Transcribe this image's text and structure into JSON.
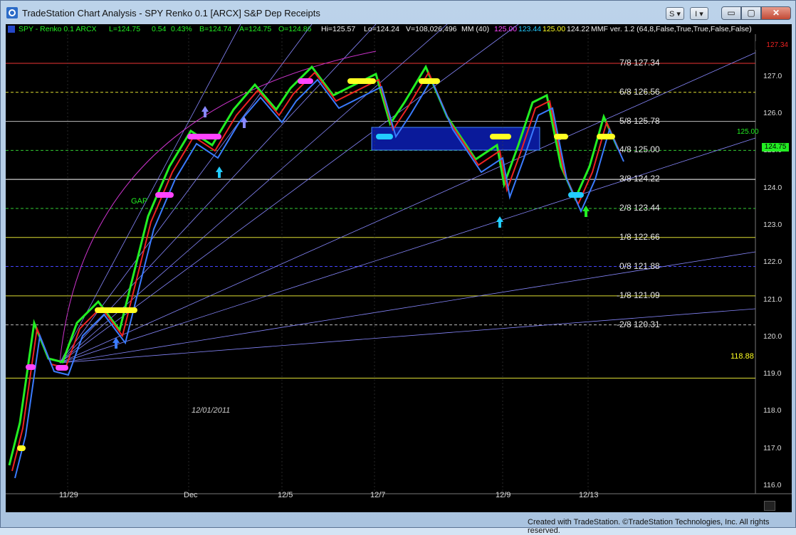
{
  "window": {
    "title": "TradeStation Chart Analysis - SPY Renko 0.1 [ARCX] S&P Dep Receipts",
    "btn_s": "S",
    "btn_i": "I",
    "btn_min": "▭",
    "btn_restore": "▢",
    "btn_close": "✕"
  },
  "header": {
    "symbol": "SPY - Renko 0.1  ARCX",
    "last": "L=124.75",
    "chg": "0.54",
    "pct": "0.43%",
    "bid": "B=124.74",
    "ask": "A=124.75",
    "open": "O=124.86",
    "hi": "Hi=125.57",
    "lo": "Lo=124.24",
    "vol": "V=108,026,496",
    "mm": "MM (40)",
    "mm1": "125.00",
    "mm2": "123.44",
    "mm3": "125.00",
    "mm4": "124.22",
    "mmf": "MMF ver. 1.2 (64,8,False,True,True,False,False)"
  },
  "colors": {
    "green": "#22ee22",
    "red": "#ee2222",
    "magenta": "#ff44ff",
    "yellow": "#ffff22",
    "cyan": "#22ccff",
    "white": "#ffffff",
    "blue": "#3a7bff",
    "navy": "#101a8a"
  },
  "fib_levels": [
    {
      "label": "7/8",
      "value": "127.34",
      "y": 127.34,
      "color": "#ee3333"
    },
    {
      "label": "6/8",
      "value": "126.56",
      "y": 126.56,
      "color": "#dddd33"
    },
    {
      "label": "5/8",
      "value": "125.78",
      "y": 125.78,
      "color": "#bbbbbb"
    },
    {
      "label": "4/8",
      "value": "125.00",
      "y": 125.0,
      "color": "#33cc33"
    },
    {
      "label": "3/8",
      "value": "124.22",
      "y": 124.22,
      "color": "#ffffff"
    },
    {
      "label": "2/8",
      "value": "123.44",
      "y": 123.44,
      "color": "#33cc33"
    },
    {
      "label": "1/8",
      "value": "122.66",
      "y": 122.66,
      "color": "#dddd33"
    },
    {
      "label": "0/8",
      "value": "121.88",
      "y": 121.88,
      "color": "#4444ff"
    },
    {
      "label": "-1/8",
      "value": "121.09",
      "y": 121.09,
      "color": "#dddd33"
    },
    {
      "label": "-2/8",
      "value": "120.31",
      "y": 120.31,
      "color": "#bbbbbb"
    }
  ],
  "axis_labels": [
    "127.0",
    "126.0",
    "125.0",
    "124.0",
    "123.0",
    "122.0",
    "121.0",
    "120.0",
    "119.0",
    "118.0",
    "117.0",
    "116.0"
  ],
  "price_tags": {
    "red": "127.34",
    "green": "125.00",
    "yellow": "118.88",
    "last": "124.75"
  },
  "dates": [
    "11/29",
    "Dec",
    "12/5",
    "12/7",
    "12/9",
    "12/13"
  ],
  "annotations": {
    "gap": "GAP",
    "date_note": "12/01/2011"
  },
  "footer": "Created with TradeStation. ©TradeStation Technologies, Inc. All rights reserved."
}
